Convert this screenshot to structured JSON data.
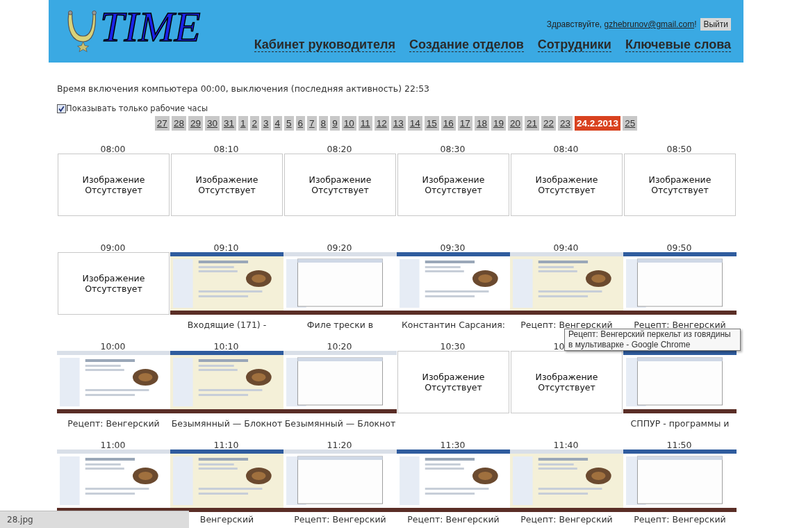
{
  "header": {
    "logo_text": "TIME",
    "greeting": "Здравствуйте, ",
    "email": "gzhebrunov@gmail.com",
    "greeting_end": "!",
    "logout": "Выйти",
    "nav": [
      "Кабинет руководителя",
      "Создание отделов",
      "Сотрудники",
      "Ключевые слова"
    ]
  },
  "info": "Время включения компьютера 00:00, выключения (последняя активность) 22:53",
  "work_hours": {
    "label": "Показывать только рабочие часы",
    "checked": true
  },
  "dates": [
    {
      "label": "27",
      "selected": false
    },
    {
      "label": "28",
      "selected": false
    },
    {
      "label": "29",
      "selected": false
    },
    {
      "label": "30",
      "selected": false
    },
    {
      "label": "31",
      "selected": false
    },
    {
      "label": "1",
      "selected": false
    },
    {
      "label": "2",
      "selected": false
    },
    {
      "label": "3",
      "selected": false
    },
    {
      "label": "4",
      "selected": false
    },
    {
      "label": "5",
      "selected": false
    },
    {
      "label": "6",
      "selected": false
    },
    {
      "label": "7",
      "selected": false
    },
    {
      "label": "8",
      "selected": false
    },
    {
      "label": "9",
      "selected": false
    },
    {
      "label": "10",
      "selected": false
    },
    {
      "label": "11",
      "selected": false
    },
    {
      "label": "12",
      "selected": false
    },
    {
      "label": "13",
      "selected": false
    },
    {
      "label": "14",
      "selected": false
    },
    {
      "label": "15",
      "selected": false
    },
    {
      "label": "16",
      "selected": false
    },
    {
      "label": "17",
      "selected": false
    },
    {
      "label": "18",
      "selected": false
    },
    {
      "label": "19",
      "selected": false
    },
    {
      "label": "20",
      "selected": false
    },
    {
      "label": "21",
      "selected": false
    },
    {
      "label": "22",
      "selected": false
    },
    {
      "label": "23",
      "selected": false
    },
    {
      "label": "24.2.2013",
      "selected": true
    },
    {
      "label": "25",
      "selected": false
    }
  ],
  "rows": [
    [
      {
        "time": "08:00",
        "kind": "missing",
        "text": "Изображение Отсутствует"
      },
      {
        "time": "08:10",
        "kind": "missing",
        "text": "Изображение Отсутствует"
      },
      {
        "time": "08:20",
        "kind": "missing",
        "text": "Изображение Отсутствует"
      },
      {
        "time": "08:30",
        "kind": "missing",
        "text": "Изображение Отсутствует"
      },
      {
        "time": "08:40",
        "kind": "missing",
        "text": "Изображение Отсутствует"
      },
      {
        "time": "08:50",
        "kind": "missing",
        "text": "Изображение Отсутствует"
      }
    ],
    [
      {
        "time": "09:00",
        "kind": "missing",
        "text": "Изображение Отсутствует"
      },
      {
        "time": "09:10",
        "kind": "picture",
        "caption": "Входящие (171) -"
      },
      {
        "time": "09:20",
        "kind": "picture",
        "caption": "Филе трески в"
      },
      {
        "time": "09:30",
        "kind": "picture",
        "caption": "Константин Сарсания:"
      },
      {
        "time": "09:40",
        "kind": "picture",
        "caption": "Рецепт: Венгерский"
      },
      {
        "time": "09:50",
        "kind": "picture",
        "caption": "Рецепт: Венгерский"
      }
    ],
    [
      {
        "time": "10:00",
        "kind": "picture",
        "caption": "Рецепт: Венгерский"
      },
      {
        "time": "10:10",
        "kind": "picture",
        "caption": "Безымянный — Блокнот"
      },
      {
        "time": "10:20",
        "kind": "picture",
        "caption": "Безымянный — Блокнот"
      },
      {
        "time": "10:30",
        "kind": "missing",
        "text": "Изображение Отсутствует"
      },
      {
        "time": "10",
        "kind": "missing",
        "text": "Изображение Отсутствует"
      },
      {
        "kind": "picture",
        "caption": "СППУР - программы и"
      }
    ],
    [
      {
        "time": "11:00",
        "kind": "picture"
      },
      {
        "time": "11:10",
        "kind": "picture",
        "caption": "Венгерский"
      },
      {
        "time": "11:20",
        "kind": "picture",
        "caption": "Рецепт: Венгерский"
      },
      {
        "time": "11:30",
        "kind": "picture",
        "caption": "Рецепт: Венгерский"
      },
      {
        "time": "11:40",
        "kind": "picture",
        "caption": "Рецепт: Венгерский"
      },
      {
        "time": "11:50",
        "kind": "picture",
        "caption": "Рецепт: Венгерский"
      }
    ]
  ],
  "tooltip": "Рецепт: Венгерский перкельт из говядины в мультиварке - Google Chrome",
  "status_bar": "28.jpg"
}
